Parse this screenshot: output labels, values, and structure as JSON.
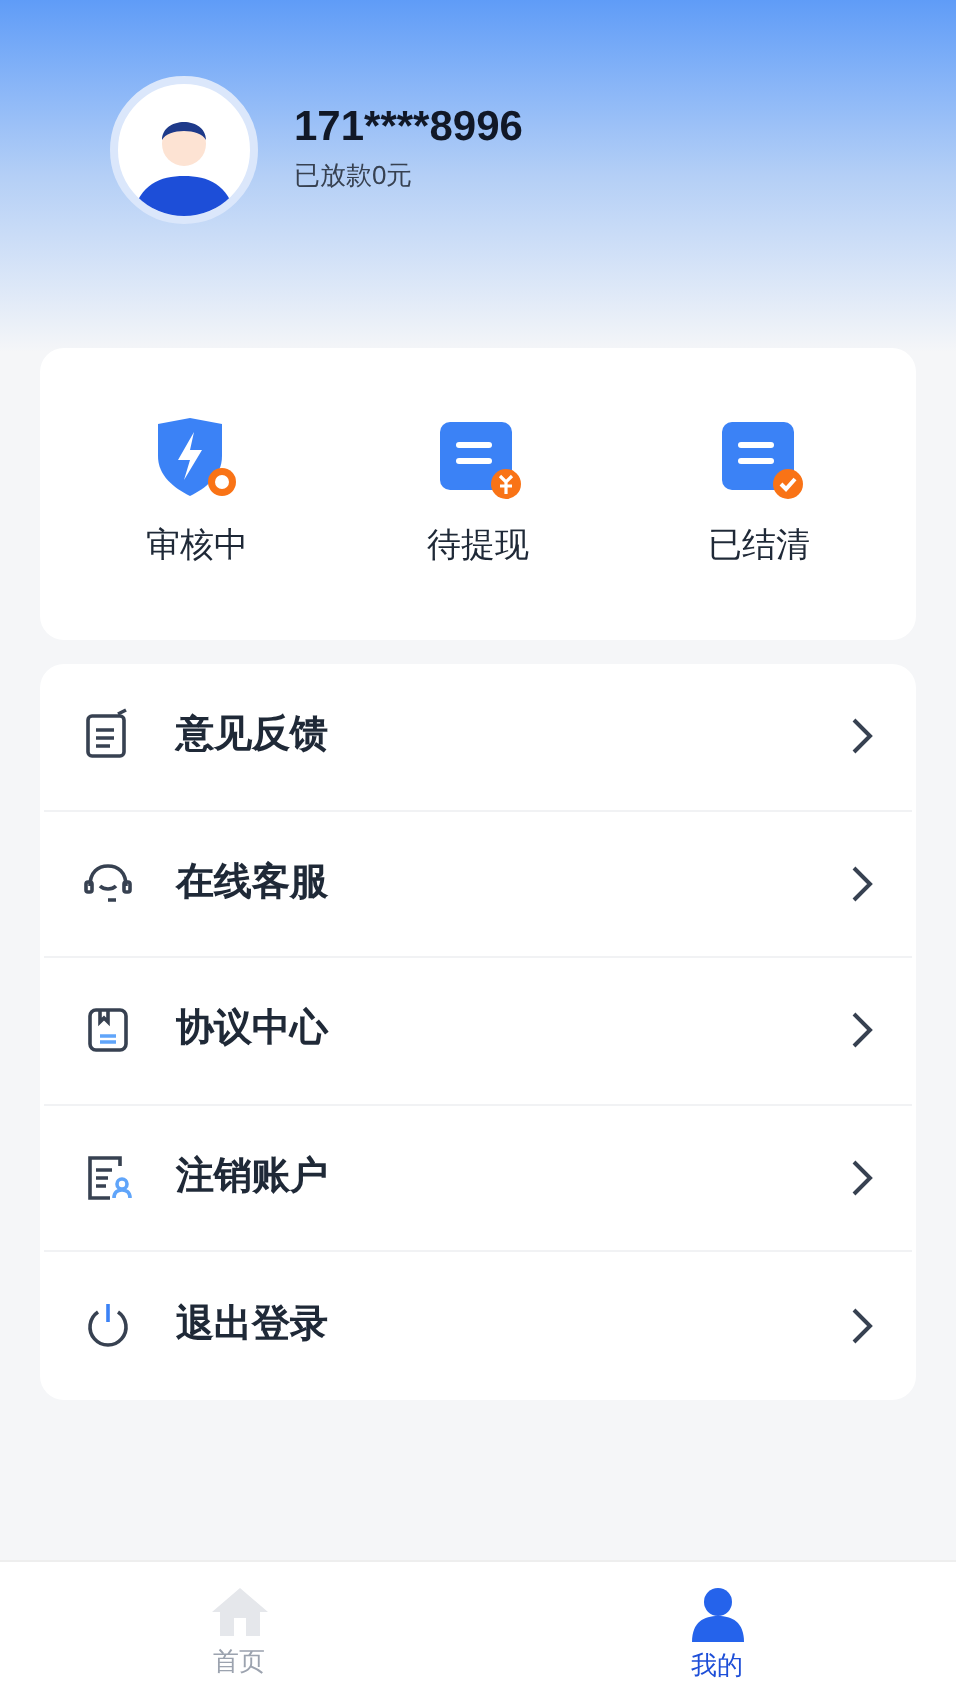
{
  "profile": {
    "phone": "171****8996",
    "subtitle": "已放款0元"
  },
  "status": [
    {
      "kind": "review",
      "label": "审核中"
    },
    {
      "kind": "withdraw",
      "label": "待提现"
    },
    {
      "kind": "settled",
      "label": "已结清"
    }
  ],
  "menu": [
    {
      "kind": "feedback",
      "label": "意见反馈"
    },
    {
      "kind": "service",
      "label": "在线客服"
    },
    {
      "kind": "agreement",
      "label": "协议中心"
    },
    {
      "kind": "cancel",
      "label": "注销账户"
    },
    {
      "kind": "logout",
      "label": "退出登录"
    }
  ],
  "tabs": [
    {
      "kind": "home",
      "label": "首页",
      "selected": false
    },
    {
      "kind": "me",
      "label": "我的",
      "selected": true
    }
  ]
}
